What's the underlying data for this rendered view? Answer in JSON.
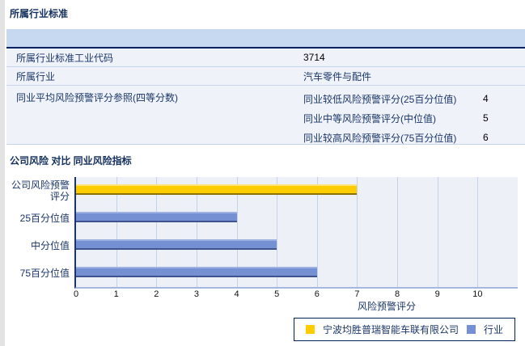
{
  "colors": {
    "title_navy": "#13305f",
    "label_navy": "#1a3668",
    "header_rule_navy": "#002060",
    "table_header_bg": "#c7d9f1",
    "table_row_bg": "#eff2f9",
    "row_separator": "#c6d5ec",
    "plot_bg": "#edf0f7",
    "gridline": "#c3d2ea",
    "company_yellow": "#ffcc00",
    "industry_blue": "#7590d3"
  },
  "section1": {
    "title": "所属行业标准",
    "table": {
      "rows": [
        {
          "label": "所属行业标准工业代码",
          "value": "3714"
        },
        {
          "label": "所属行业",
          "value": "汽车零件与配件"
        },
        {
          "label": "同业平均风险预警评分参照(四等分数)",
          "subrows": [
            {
              "label": "同业较低风险预警评分(25百分位值)",
              "value": "4"
            },
            {
              "label": "同业中等风险预警评分(中位值)",
              "value": "5"
            },
            {
              "label": "同业较高风险预警评分(75百分位值)",
              "value": "6"
            }
          ]
        }
      ]
    }
  },
  "section2": {
    "title": "公司风险 对比 同业风险指标"
  },
  "chart_data": {
    "type": "bar",
    "orientation": "horizontal",
    "title": "公司风险 对比 同业风险指标",
    "categories": [
      "公司风险预警评分",
      "25百分位值",
      "中分位值",
      "75百分位值"
    ],
    "values": [
      7,
      4,
      5,
      6
    ],
    "bars": [
      {
        "category": "公司风险预警评分",
        "series": "宁波均胜普瑞智能车联有限公司",
        "value": 7,
        "color": "#ffcc00",
        "edge_light": "#ffe479",
        "edge_dark": "#8a7100"
      },
      {
        "category": "25百分位值",
        "series": "行业",
        "value": 4,
        "color": "#7590d3",
        "edge_light": "#9db1e3",
        "edge_dark": "#3f538d"
      },
      {
        "category": "中分位值",
        "series": "行业",
        "value": 5,
        "color": "#7590d3",
        "edge_light": "#9db1e3",
        "edge_dark": "#3f538d"
      },
      {
        "category": "75百分位值",
        "series": "行业",
        "value": 6,
        "color": "#7590d3",
        "edge_light": "#9db1e3",
        "edge_dark": "#3f538d"
      }
    ],
    "xlabel": "风险预警评分",
    "ylabel": "",
    "xlim": [
      0,
      11
    ],
    "xticks": [
      0,
      1,
      2,
      3,
      4,
      5,
      6,
      7,
      8,
      9,
      10
    ],
    "grid": true,
    "legend": {
      "position": "bottom-right",
      "entries": [
        {
          "label": "宁波均胜普瑞智能车联有限公司",
          "color": "#ffcc00"
        },
        {
          "label": "行业",
          "color": "#7590d3"
        }
      ]
    }
  }
}
